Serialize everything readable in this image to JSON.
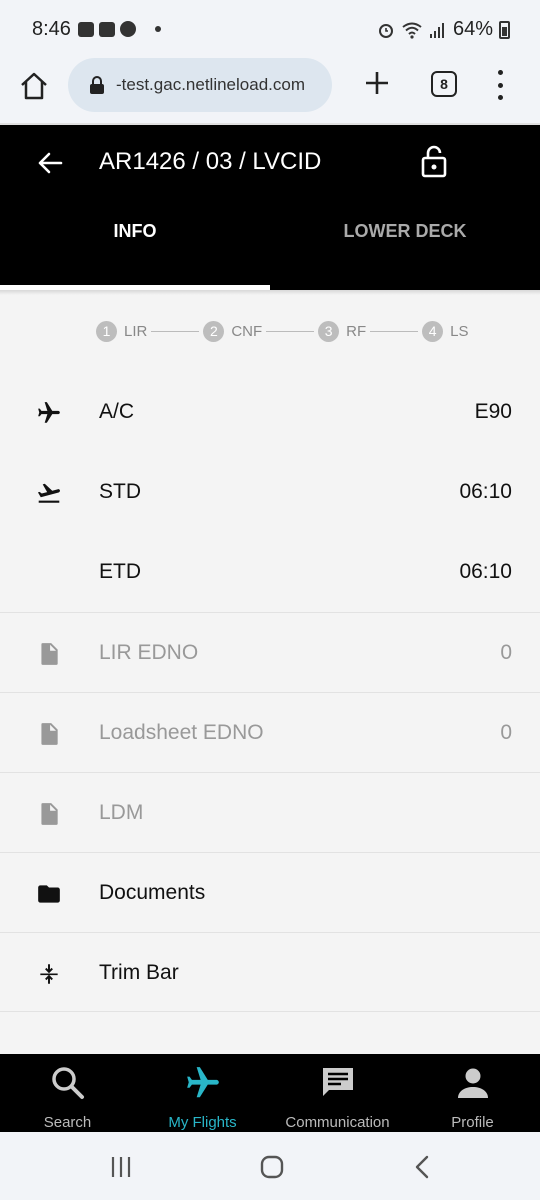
{
  "status_bar": {
    "time": "8:46",
    "battery": "64%",
    "icons": [
      "gallery-icon",
      "youtube-icon",
      "pinterest-icon",
      "alarm-icon",
      "wifi-icon",
      "signal-icon",
      "battery-icon"
    ]
  },
  "browser": {
    "url": "-test.gac.netlineload.com",
    "tab_count": "8"
  },
  "header": {
    "title": "AR1426 / 03 / LVCID",
    "tabs": [
      {
        "label": "INFO",
        "active": true
      },
      {
        "label": "LOWER DECK",
        "active": false
      }
    ]
  },
  "stepper": [
    {
      "num": "1",
      "label": "LIR"
    },
    {
      "num": "2",
      "label": "CNF"
    },
    {
      "num": "3",
      "label": "RF"
    },
    {
      "num": "4",
      "label": "LS"
    }
  ],
  "rows": [
    {
      "icon": "airplane-icon",
      "label": "A/C",
      "value": "E90"
    },
    {
      "icon": "takeoff-icon",
      "label": "STD",
      "value": "06:10"
    },
    {
      "icon": "",
      "label": "ETD",
      "value": "06:10"
    },
    {
      "icon": "document-icon",
      "label": "LIR EDNO",
      "value": "0"
    },
    {
      "icon": "document-icon",
      "label": "Loadsheet EDNO",
      "value": "0"
    },
    {
      "icon": "document-icon",
      "label": "LDM",
      "value": ""
    },
    {
      "icon": "folder-icon",
      "label": "Documents",
      "value": ""
    },
    {
      "icon": "trim-icon",
      "label": "Trim Bar",
      "value": ""
    }
  ],
  "bottom_nav": [
    {
      "icon": "search-icon",
      "label": "Search",
      "active": false
    },
    {
      "icon": "airplane-icon",
      "label": "My Flights",
      "active": true
    },
    {
      "icon": "chat-icon",
      "label": "Communication",
      "active": false
    },
    {
      "icon": "profile-icon",
      "label": "Profile",
      "active": false
    }
  ],
  "colors": {
    "accent": "#29b6c8",
    "header_bg": "#000000",
    "dim_text": "#999999"
  }
}
